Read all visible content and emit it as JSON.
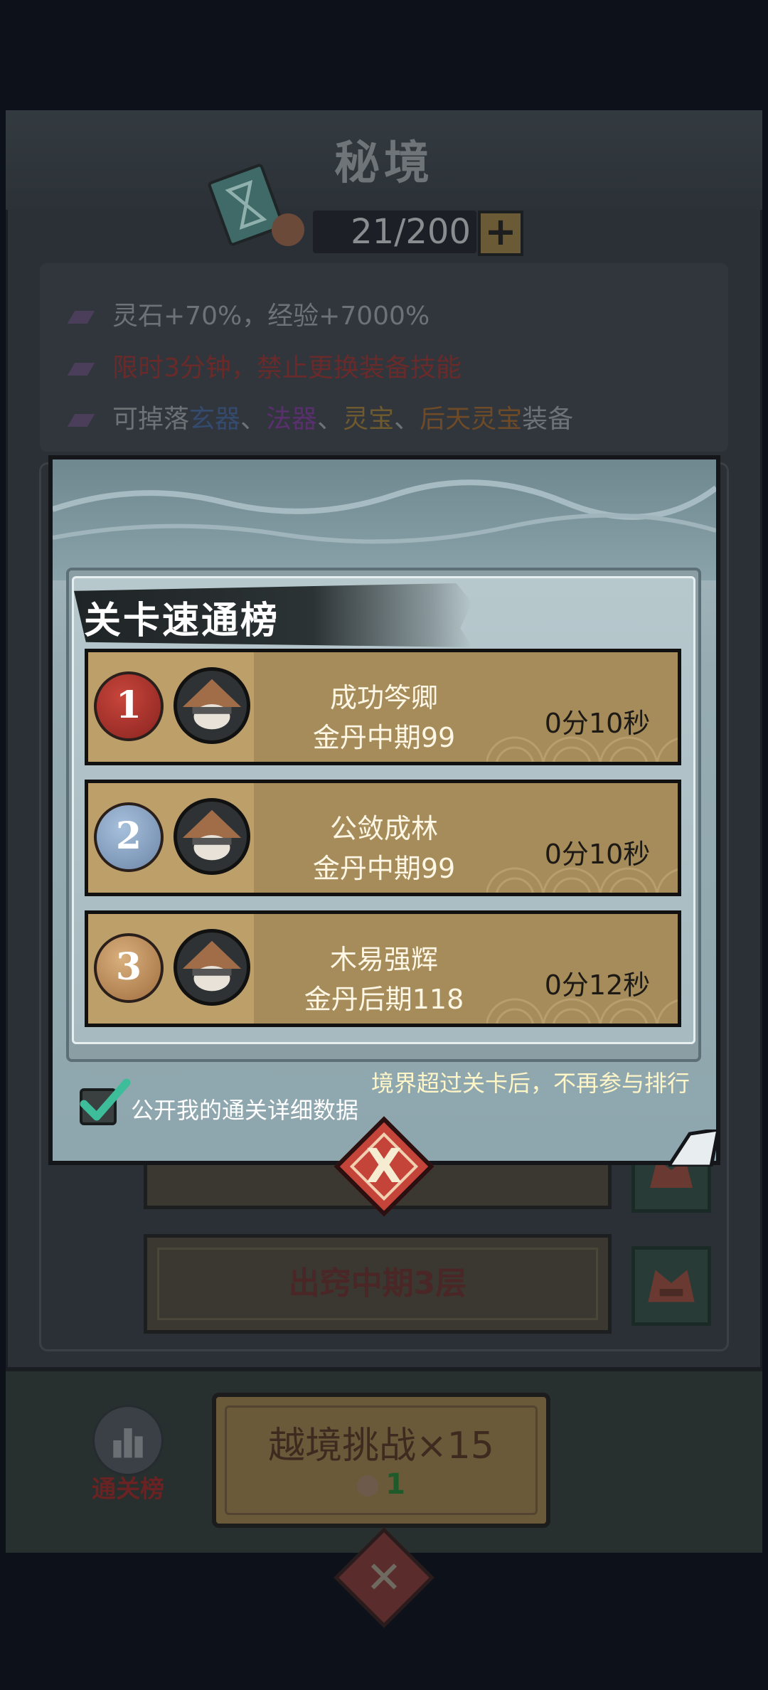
{
  "screen": {
    "title": "秘境",
    "counter": "21/200",
    "plus_label": "+",
    "info_lines": [
      {
        "parts": [
          {
            "text": "灵石+70%，经验+7000%",
            "cls": ""
          }
        ]
      },
      {
        "parts": [
          {
            "text": "限时3分钟，禁止更换装备技能",
            "cls": "c-red"
          }
        ]
      },
      {
        "parts": [
          {
            "text": "可掉落",
            "cls": ""
          },
          {
            "text": "玄器",
            "cls": "c-blue"
          },
          {
            "text": "、",
            "cls": ""
          },
          {
            "text": "法器",
            "cls": "c-purple"
          },
          {
            "text": "、",
            "cls": ""
          },
          {
            "text": "灵宝",
            "cls": "c-gold"
          },
          {
            "text": "、",
            "cls": ""
          },
          {
            "text": "后天灵宝",
            "cls": "c-orange"
          },
          {
            "text": "装备",
            "cls": ""
          }
        ]
      }
    ],
    "level_button": "出窍中期3层",
    "rank_label": "通关榜",
    "challenge_label": "越境挑战×15",
    "challenge_cost": "1"
  },
  "modal": {
    "title": "关卡速通榜",
    "rows": [
      {
        "rank": "1",
        "name": "成功笒卿",
        "realm": "金丹中期99",
        "time": "0分10秒"
      },
      {
        "rank": "2",
        "name": "公敛成林",
        "realm": "金丹中期99",
        "time": "0分10秒"
      },
      {
        "rank": "3",
        "name": "木易强辉",
        "realm": "金丹后期118",
        "time": "0分12秒"
      }
    ],
    "rule_note": "境界超过关卡后，不再参与排行",
    "checkbox_label": "公开我的通关详细数据",
    "checkbox_checked": true,
    "close_label": "X"
  },
  "colors": {
    "accent_red": "#c4443a",
    "row_gold": "#a68c5a",
    "check_green": "#3dbd9a"
  }
}
